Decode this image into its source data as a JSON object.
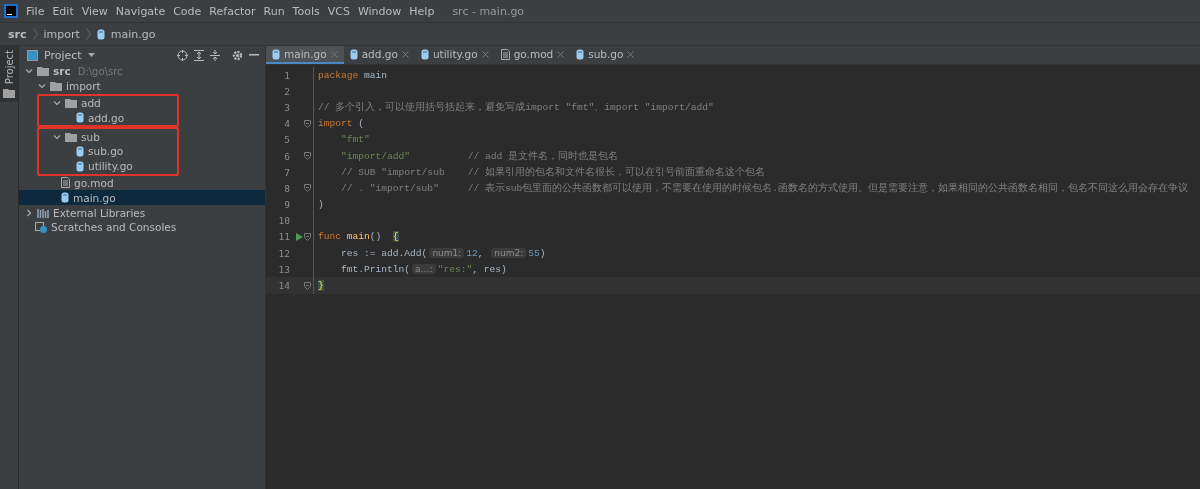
{
  "menu_bar": {
    "items": [
      "File",
      "Edit",
      "View",
      "Navigate",
      "Code",
      "Refactor",
      "Run",
      "Tools",
      "VCS",
      "Window",
      "Help"
    ],
    "title": "src - main.go"
  },
  "breadcrumb": [
    {
      "label": "src",
      "kind": "root"
    },
    {
      "label": "import",
      "kind": "folder"
    },
    {
      "label": "main.go",
      "kind": "gofile"
    }
  ],
  "side_strip": {
    "label": "Project"
  },
  "project_panel": {
    "title": "Project",
    "tree": [
      {
        "label": "src",
        "path": "D:\\go\\src",
        "kind": "folder",
        "expanded": true,
        "selected": false,
        "children": [
          {
            "label": "import",
            "kind": "folder",
            "expanded": true,
            "selected": false,
            "children": [
              {
                "label": "add",
                "kind": "folder",
                "expanded": true,
                "selected": false,
                "highlighted": true,
                "children": [
                  {
                    "label": "add.go",
                    "kind": "gofile",
                    "selected": false
                  }
                ]
              },
              {
                "label": "sub",
                "kind": "folder",
                "expanded": true,
                "selected": false,
                "highlighted": true,
                "children": [
                  {
                    "label": "sub.go",
                    "kind": "gofile",
                    "selected": false
                  },
                  {
                    "label": "utility.go",
                    "kind": "gofile",
                    "selected": false
                  }
                ]
              },
              {
                "label": "go.mod",
                "kind": "modfile",
                "selected": false
              },
              {
                "label": "main.go",
                "kind": "gofile",
                "selected": true
              }
            ]
          }
        ]
      },
      {
        "label": "External Libraries",
        "kind": "library",
        "expanded": false,
        "selected": false
      },
      {
        "label": "Scratches and Consoles",
        "kind": "scratch",
        "selected": false
      }
    ]
  },
  "tabs": [
    {
      "label": "main.go",
      "kind": "gofile",
      "selected": true
    },
    {
      "label": "add.go",
      "kind": "gofile",
      "selected": false
    },
    {
      "label": "utility.go",
      "kind": "gofile",
      "selected": false
    },
    {
      "label": "go.mod",
      "kind": "modfile",
      "selected": false
    },
    {
      "label": "sub.go",
      "kind": "gofile",
      "selected": false
    }
  ],
  "editor": {
    "lines": [
      {
        "number": "1",
        "tokens": [
          {
            "kind": "keyword",
            "text": "package"
          },
          {
            "kind": "ident",
            "text": "main"
          }
        ]
      },
      {
        "number": "2"
      },
      {
        "number": "3",
        "tokens": [
          {
            "kind": "comment",
            "text": "// 多个引入，可以使用括号括起来，避免写成import \"fmt\"、import \"import/add\""
          }
        ]
      },
      {
        "number": "4",
        "fold": true,
        "tokens": [
          {
            "kind": "keyword",
            "text": "import"
          },
          {
            "kind": "plain",
            "text": "("
          }
        ]
      },
      {
        "number": "5",
        "indented": true,
        "tokens": [
          {
            "kind": "string",
            "text": "\"fmt\""
          }
        ]
      },
      {
        "number": "6",
        "fold": true,
        "indented": true,
        "tokens": [
          {
            "kind": "string",
            "text": "\"import/add\""
          },
          {
            "kind": "trailing_comment",
            "text": "// add 是文件名，同时也是包名"
          }
        ]
      },
      {
        "number": "7",
        "indented": true,
        "tokens": [
          {
            "kind": "comment",
            "text": "// SUB \"import/sub"
          },
          {
            "kind": "trailing_comment",
            "text": "// 如果引用的包名和文件名很长，可以在引号前面重命名这个包名"
          }
        ]
      },
      {
        "number": "8",
        "fold": true,
        "indented": true,
        "tokens": [
          {
            "kind": "comment",
            "text": "// . \"import/sub\""
          },
          {
            "kind": "trailing_comment",
            "text": "// 表示sub包里面的公共函数都可以使用，不需要在使用的时候包名.函数名的方式使用。但是需要注意，如果相同的公共函数名相同，包名不同这么用会存在争议"
          }
        ]
      },
      {
        "number": "9",
        "tokens": [
          {
            "kind": "plain",
            "text": ")"
          }
        ]
      },
      {
        "number": "10"
      },
      {
        "number": "11",
        "run": true,
        "fold": true,
        "tokens": [
          {
            "kind": "keyword",
            "text": "func"
          },
          {
            "kind": "func",
            "text": "main"
          },
          {
            "kind": "plain",
            "text": "()  "
          },
          {
            "kind": "brace",
            "text": "{"
          }
        ]
      },
      {
        "number": "12",
        "indented": true,
        "tokens": [
          {
            "kind": "plain",
            "text": "res := add.Add("
          },
          {
            "kind": "hint",
            "text": "num1:"
          },
          {
            "kind": "number",
            "text": "12"
          },
          {
            "kind": "plain",
            "text": ", "
          },
          {
            "kind": "hint",
            "text": "num2:"
          },
          {
            "kind": "number",
            "text": "55"
          },
          {
            "kind": "plain",
            "text": ")"
          }
        ]
      },
      {
        "number": "13",
        "indented": true,
        "tokens": [
          {
            "kind": "plain",
            "text": "fmt.Println("
          },
          {
            "kind": "hint",
            "text": "a…:"
          },
          {
            "kind": "string",
            "text": "\"res:\""
          },
          {
            "kind": "plain",
            "text": ", res)"
          }
        ]
      },
      {
        "number": "14",
        "current": true,
        "fold": true,
        "tokens": [
          {
            "kind": "brace",
            "text": "}"
          }
        ]
      }
    ]
  }
}
